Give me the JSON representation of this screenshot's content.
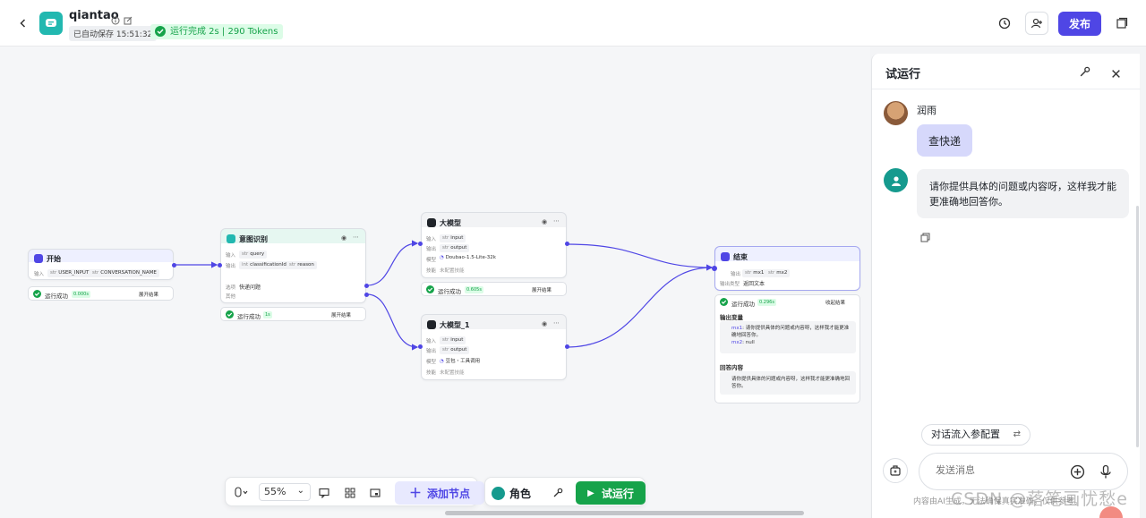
{
  "header": {
    "app_name": "qiantao",
    "autosave": "已自动保存 15:51:32",
    "run_status": "运行完成 2s | 290 Tokens",
    "publish_label": "发布"
  },
  "nodes": {
    "start": {
      "title": "开始",
      "input_label": "输入",
      "vars": [
        "USER_INPUT",
        "CONVERSATION_NAME"
      ],
      "status": "运行成功",
      "time": "0.000s",
      "expand": "展开结果"
    },
    "intent": {
      "title": "意图识别",
      "input_label": "输入",
      "input_var": "query",
      "output_label": "输出",
      "output_vars": [
        "classificationId",
        "reason"
      ],
      "option_label": "选项",
      "option_value": "快递问题",
      "other_label": "其他",
      "status": "运行成功",
      "time": "1s",
      "expand": "展开结果"
    },
    "llm1": {
      "title": "大模型",
      "input_label": "输入",
      "input_var": "input",
      "output_label": "输出",
      "output_var": "output",
      "model_label": "模型",
      "model_value": "Doubao-1.5-Lite-32k",
      "skill_label": "技能",
      "skill_value": "未配置技能",
      "status": "运行成功",
      "time": "0.605s",
      "expand": "展开结果"
    },
    "llm2": {
      "title": "大模型_1",
      "input_label": "输入",
      "input_var": "input",
      "output_label": "输出",
      "output_var": "output",
      "model_label": "模型",
      "model_value": "豆包・工具调用",
      "skill_label": "技能",
      "skill_value": "未配置技能"
    },
    "end": {
      "title": "结束",
      "output_label": "输出",
      "output_vars": [
        "mx1",
        "mx2"
      ],
      "output_type_label": "输出类型",
      "output_type_value": "返回文本",
      "status": "运行成功",
      "time": "0.296s",
      "collapse": "收起结果",
      "out_vars_title": "输出变量",
      "mx1_key": "mx1",
      "mx1_val": ": 请你提供具体的问题或内容呀，这样我才能更准确地回答你。",
      "mx2_key": "mx2",
      "mx2_val": ": null",
      "answer_title": "回答内容",
      "answer_text": "请你提供具体的问题或内容呀，这样我才能更准确地回答你。"
    }
  },
  "toolbar": {
    "zoom": "55%",
    "add_node": "添加节点",
    "role": "角色",
    "try_run": "试运行"
  },
  "panel": {
    "title": "试运行",
    "user_name": "润雨",
    "user_message": "查快递",
    "bot_message": "请你提供具体的问题或内容呀，这样我才能更准确地回答你。",
    "config_button": "对话流入参配置",
    "input_placeholder": "发送消息",
    "footer": "内容由AI生成，无法确保真实准确，仅供参考。"
  },
  "watermark": "CSDN @落笔画忧愁e",
  "colors": {
    "primary": "#4f46e5",
    "success": "#16a34a",
    "teal": "#22b8b0"
  }
}
